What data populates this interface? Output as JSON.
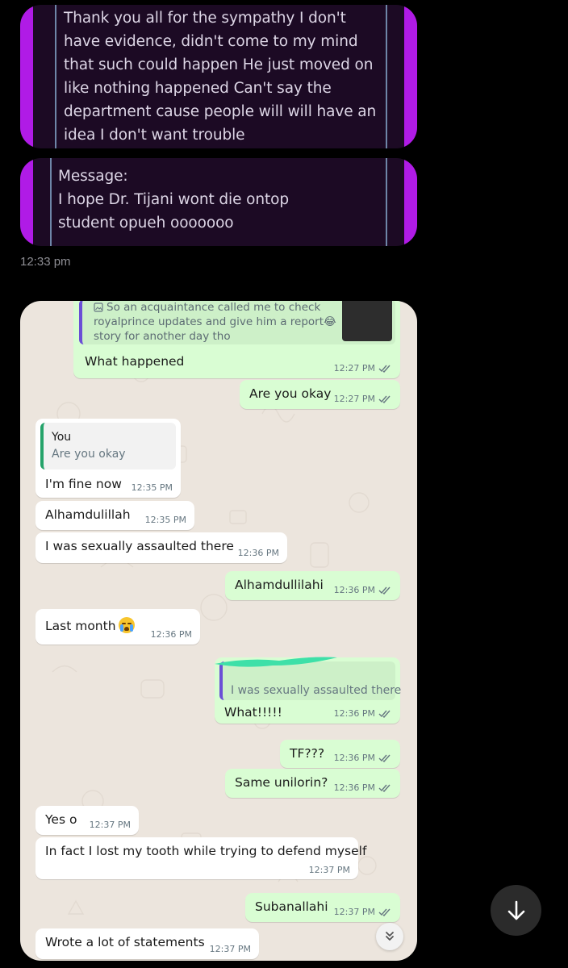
{
  "top_messages": {
    "card1_text": "Thank you all for the sympathy I don't have evidence, didn't come to my mind that such could happen He just moved on like nothing happened Can't say the department cause people will will have an idea I don't want trouble",
    "card2_label": "Message:",
    "card2_text": "I hope Dr. Tijani wont die ontop student opueh ooooooo",
    "timestamp": "12:33 pm"
  },
  "chat": {
    "quoted_top": {
      "line1": "So an acquaintance called me to check",
      "line2": "royalprince updates and give him a report😂",
      "line3": "story for another day tho"
    },
    "messages": [
      {
        "dir": "out",
        "text": "What happened",
        "time": "12:27 PM"
      },
      {
        "dir": "out",
        "text": "Are you okay",
        "time": "12:27 PM"
      },
      {
        "dir": "in",
        "quote_author": "You",
        "quote_text": "Are you okay",
        "text": "I'm fine now",
        "time": "12:35 PM"
      },
      {
        "dir": "in",
        "text": "Alhamdulillah",
        "time": "12:35 PM"
      },
      {
        "dir": "in",
        "text": "I was sexually assaulted there",
        "time": "12:36 PM"
      },
      {
        "dir": "out",
        "text": "Alhamdullilahi",
        "time": "12:36 PM"
      },
      {
        "dir": "in",
        "text": "Last month",
        "time": "12:36 PM"
      },
      {
        "dir": "out",
        "quote_text": "I was sexually assaulted there",
        "text": "What!!!!!",
        "time": "12:36 PM"
      },
      {
        "dir": "out",
        "text": "TF???",
        "time": "12:36 PM"
      },
      {
        "dir": "out",
        "text": "Same unilorin?",
        "time": "12:36 PM"
      },
      {
        "dir": "in",
        "text": "Yes o",
        "time": "12:37 PM"
      },
      {
        "dir": "in",
        "text": "In fact I lost my tooth while trying to defend myself",
        "time": "12:37 PM"
      },
      {
        "dir": "out",
        "text": "Subanallahi",
        "time": "12:37 PM"
      },
      {
        "dir": "in",
        "text": "Wrote a lot of statements",
        "time": "12:37 PM"
      }
    ]
  },
  "icons": {
    "scroll_down": "arrow-down-icon",
    "wa_scroll": "double-chevron-down-icon",
    "read_receipt": "double-check-icon",
    "image_attachment": "image-icon"
  },
  "colors": {
    "card_bg": "#1c0a24",
    "card_edge": "#b01be6",
    "out_bubble": "#d9fdd3",
    "in_bubble": "#ffffff",
    "chat_bg": "#ece5dd",
    "quote_in_bar": "#25a36a",
    "quote_out_bar": "#6a4fd6",
    "scribble": "#3ee0a8"
  }
}
